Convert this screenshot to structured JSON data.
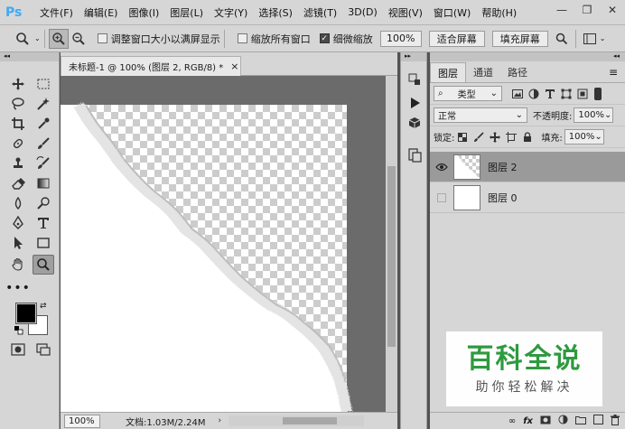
{
  "app": {
    "logo": "Ps"
  },
  "menu": [
    "文件(F)",
    "编辑(E)",
    "图像(I)",
    "图层(L)",
    "文字(Y)",
    "选择(S)",
    "滤镜(T)",
    "3D(D)",
    "视图(V)",
    "窗口(W)",
    "帮助(H)"
  ],
  "options": {
    "resize_windows_label": "调整窗口大小以满屏显示",
    "zoom_all_label": "缩放所有窗口",
    "scrubby_zoom_label": "细微缩放",
    "zoom_value": "100%",
    "fit_screen": "适合屏幕",
    "fill_screen": "填充屏幕"
  },
  "document": {
    "tab_title": "未标题-1 @ 100% (图层 2, RGB/8) *",
    "close_glyph": "×",
    "status_zoom": "100%",
    "status_doc": "文档:1.03M/2.24M"
  },
  "panel": {
    "tabs": [
      "图层",
      "通道",
      "路径"
    ],
    "filter_kind": "类型",
    "blend_mode": "正常",
    "opacity_label": "不透明度:",
    "opacity_value": "100%",
    "lock_label": "锁定:",
    "fill_label": "填充:",
    "fill_value": "100%",
    "layers": [
      {
        "name": "图层 2",
        "visible": true,
        "selected": true
      },
      {
        "name": "图层 0",
        "visible": false,
        "selected": false
      }
    ]
  },
  "watermark": {
    "title": "百科全说",
    "subtitle": "助你轻松解决"
  },
  "colors": {
    "foreground": "#000000",
    "background": "#ffffff",
    "watermark_green": "#2e9a3f"
  }
}
